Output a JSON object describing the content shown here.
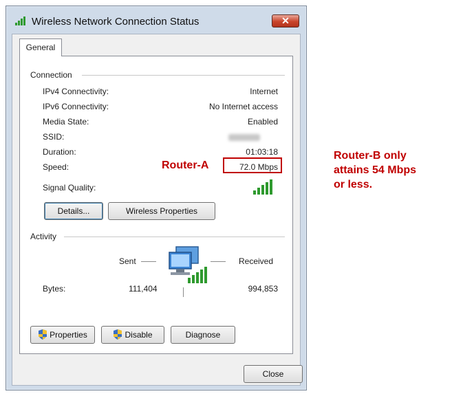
{
  "window": {
    "title": "Wireless Network Connection Status",
    "close_glyph": "✕",
    "title_icon": "signal-bars-icon"
  },
  "tabs": [
    {
      "label": "General",
      "selected": true
    }
  ],
  "connection": {
    "group_label": "Connection",
    "rows": [
      {
        "label": "IPv4 Connectivity:",
        "value": "Internet"
      },
      {
        "label": "IPv6 Connectivity:",
        "value": "No Internet access"
      },
      {
        "label": "Media State:",
        "value": "Enabled"
      },
      {
        "label": "SSID:",
        "value": ""
      },
      {
        "label": "Duration:",
        "value": "01:03:18"
      },
      {
        "label": "Speed:",
        "value": "72.0 Mbps"
      }
    ],
    "signal_quality_label": "Signal Quality:",
    "signal_icon": "signal-strength-icon",
    "signal_bars_level": 5,
    "details_button": "Details...",
    "wireless_properties_button": "Wireless Properties"
  },
  "activity": {
    "group_label": "Activity",
    "sent_label": "Sent",
    "received_label": "Received",
    "bytes_label": "Bytes:",
    "bytes_sent": "111,404",
    "bytes_received": "994,853",
    "network_icon": "network-computers-icon"
  },
  "buttons": {
    "properties": "Properties",
    "disable": "Disable",
    "diagnose": "Diagnose",
    "close": "Close"
  },
  "annotations": {
    "router_a": "Router-A",
    "router_b_line1": "Router-B only",
    "router_b_line2": "attains 54 Mbps",
    "router_b_line3": "or less."
  },
  "colors": {
    "annotation_red": "#c00000",
    "signal_green": "#2f9a2f",
    "close_button_red": "#c9442b"
  }
}
